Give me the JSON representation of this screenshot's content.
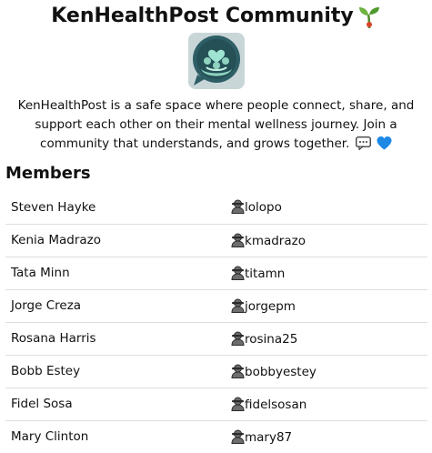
{
  "header": {
    "title": "KenHealthPost Community",
    "title_icon": "sprout-icon",
    "logo_icon": "community-heart-logo-icon",
    "description": "KenHealthPost is a safe space where people connect, share, and support each other on their mental wellness journey. Join a community that understands, and grows together.",
    "description_icons": [
      "speech-bubble-icon",
      "blue-heart-icon"
    ]
  },
  "members": {
    "heading": "Members",
    "user_icon": "user-silhouette-icon",
    "rows": [
      {
        "name": "Steven Hayke",
        "username": "lolopo"
      },
      {
        "name": "Kenia Madrazo",
        "username": "kmadrazo"
      },
      {
        "name": "Tata Minn",
        "username": "titamn"
      },
      {
        "name": "Jorge Creza",
        "username": "jorgepm"
      },
      {
        "name": "Rosana Harris",
        "username": "rosina25"
      },
      {
        "name": "Bobb Estey",
        "username": "bobbyestey"
      },
      {
        "name": "Fidel Sosa",
        "username": "fidelsosan"
      },
      {
        "name": "Mary Clinton",
        "username": "mary87"
      }
    ]
  },
  "colors": {
    "logo_background": "#2f5f66",
    "logo_accent": "#8fd3c0",
    "heart_blue": "#1e88e5",
    "sprout_green": "#5aa532",
    "sprout_red": "#d9452b"
  }
}
